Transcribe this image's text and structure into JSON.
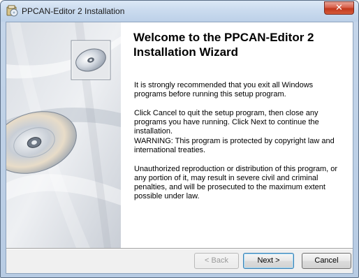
{
  "window": {
    "title": "PPCAN-Editor 2 Installation",
    "close_glyph": "✕",
    "icon": "installer-icon"
  },
  "welcome": {
    "heading": "Welcome to the PPCAN-Editor 2 Installation Wizard",
    "paragraphs": [
      "It is strongly recommended that you exit all Windows programs before running this setup program.",
      "Click Cancel to quit the setup program, then close any programs you have running.  Click Next to continue the installation.",
      "WARNING: This program is protected by copyright law and international treaties.",
      "Unauthorized reproduction or distribution of this program, or any portion of it, may result in severe civil and criminal penalties, and will be prosecuted to the maximum extent possible under law."
    ]
  },
  "buttons": {
    "back": "< Back",
    "next": "Next >",
    "cancel": "Cancel"
  },
  "colors": {
    "title_bar": "#c9daee",
    "close_button": "#c2381d",
    "panel_background": "#ffffff",
    "dialog_background": "#f0f0f0"
  }
}
